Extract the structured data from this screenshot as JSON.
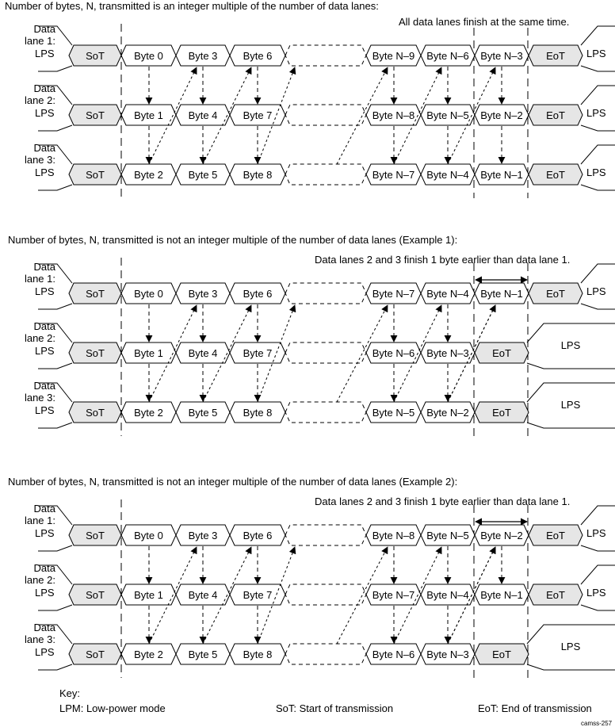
{
  "colors": {
    "stroke": "#000000",
    "sot_eot_fill": "#e6e6e6",
    "byte_fill": "#ffffff"
  },
  "sections": [
    {
      "title": "Number of bytes, N, transmitted is an integer multiple of the number of data lanes:",
      "note": "All data lanes finish at the same time.",
      "has_span_arrow": false,
      "lanes": [
        {
          "label_line1": "Data",
          "label_line2": "lane 1:",
          "lps_left": "LPS",
          "sot": "SoT",
          "bytes": [
            "Byte 0",
            "Byte 3",
            "Byte 6"
          ],
          "tail_bytes": [
            "Byte N–9",
            "Byte N–6",
            "Byte N–3"
          ],
          "eot": "EoT",
          "lps_right": "LPS"
        },
        {
          "label_line1": "Data",
          "label_line2": "lane 2:",
          "lps_left": "LPS",
          "sot": "SoT",
          "bytes": [
            "Byte 1",
            "Byte 4",
            "Byte 7"
          ],
          "tail_bytes": [
            "Byte N–8",
            "Byte N–5",
            "Byte N–2"
          ],
          "eot": "EoT",
          "lps_right": "LPS"
        },
        {
          "label_line1": "Data",
          "label_line2": "lane 3:",
          "lps_left": "LPS",
          "sot": "SoT",
          "bytes": [
            "Byte 2",
            "Byte 5",
            "Byte 8"
          ],
          "tail_bytes": [
            "Byte N–7",
            "Byte N–4",
            "Byte N–1"
          ],
          "eot": "EoT",
          "lps_right": "LPS"
        }
      ]
    },
    {
      "title": "Number of bytes, N, transmitted is not an integer multiple of the number of data lanes (Example 1):",
      "note": "Data lanes 2 and 3 finish 1 byte earlier than data lane 1.",
      "has_span_arrow": true,
      "lanes": [
        {
          "label_line1": "Data",
          "label_line2": "lane 1:",
          "lps_left": "LPS",
          "sot": "SoT",
          "bytes": [
            "Byte 0",
            "Byte 3",
            "Byte 6"
          ],
          "tail_bytes": [
            "Byte N–7",
            "Byte N–4",
            "Byte N–1"
          ],
          "eot": "EoT",
          "lps_right": "LPS"
        },
        {
          "label_line1": "Data",
          "label_line2": "lane 2:",
          "lps_left": "LPS",
          "sot": "SoT",
          "bytes": [
            "Byte 1",
            "Byte 4",
            "Byte 7"
          ],
          "tail_bytes": [
            "Byte N–6",
            "Byte N–3"
          ],
          "eot": "EoT",
          "lps_right": "LPS"
        },
        {
          "label_line1": "Data",
          "label_line2": "lane 3:",
          "lps_left": "LPS",
          "sot": "SoT",
          "bytes": [
            "Byte 2",
            "Byte 5",
            "Byte 8"
          ],
          "tail_bytes": [
            "Byte N–5",
            "Byte N–2"
          ],
          "eot": "EoT",
          "lps_right": "LPS"
        }
      ]
    },
    {
      "title": "Number of bytes, N, transmitted is not an integer multiple of the number of data lanes (Example 2):",
      "note": "Data lanes 2 and 3 finish 1 byte earlier than data lane 1.",
      "has_span_arrow": true,
      "lanes": [
        {
          "label_line1": "Data",
          "label_line2": "lane 1:",
          "lps_left": "LPS",
          "sot": "SoT",
          "bytes": [
            "Byte 0",
            "Byte 3",
            "Byte 6"
          ],
          "tail_bytes": [
            "Byte N–8",
            "Byte N–5",
            "Byte N–2"
          ],
          "eot": "EoT",
          "lps_right": "LPS"
        },
        {
          "label_line1": "Data",
          "label_line2": "lane 2:",
          "lps_left": "LPS",
          "sot": "SoT",
          "bytes": [
            "Byte 1",
            "Byte 4",
            "Byte 7"
          ],
          "tail_bytes": [
            "Byte N–7",
            "Byte N–4",
            "Byte N–1"
          ],
          "eot": "EoT",
          "lps_right": "LPS"
        },
        {
          "label_line1": "Data",
          "label_line2": "lane 3:",
          "lps_left": "LPS",
          "sot": "SoT",
          "bytes": [
            "Byte 2",
            "Byte 5",
            "Byte 8"
          ],
          "tail_bytes": [
            "Byte N–6",
            "Byte N–3"
          ],
          "eot": "EoT",
          "lps_right": "LPS"
        }
      ]
    }
  ],
  "key": {
    "heading": "Key:",
    "items": [
      "LPM: Low-power mode",
      "SoT: Start of transmission",
      "EoT: End of transmission"
    ]
  },
  "figure_id": "camss-257"
}
